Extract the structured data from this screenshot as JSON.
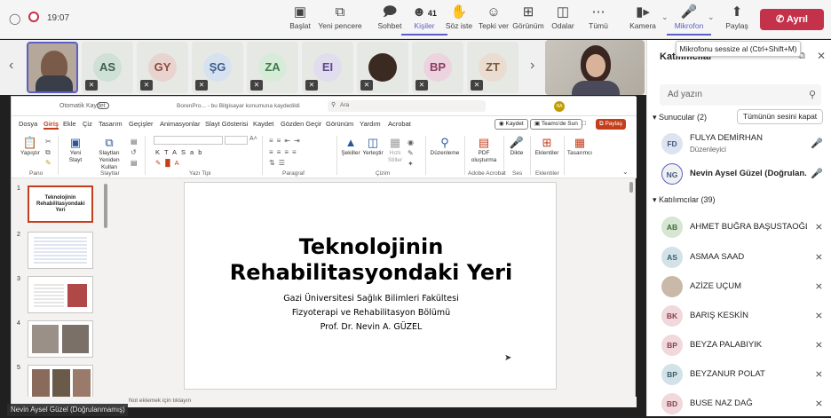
{
  "topbar": {
    "time": "19:07",
    "buttons": [
      {
        "label": "Başlat",
        "icon": "share-screen-icon"
      },
      {
        "label": "Yeni pencere",
        "icon": "new-window-icon"
      },
      {
        "label": "Sohbet",
        "icon": "chat-icon"
      },
      {
        "label": "Kişiler",
        "icon": "people-icon",
        "badge": "41"
      },
      {
        "label": "Söz iste",
        "icon": "raise-hand-icon"
      },
      {
        "label": "Tepki ver",
        "icon": "reaction-icon"
      },
      {
        "label": "Görünüm",
        "icon": "view-icon"
      },
      {
        "label": "Odalar",
        "icon": "rooms-icon"
      },
      {
        "label": "Tümü",
        "icon": "more-icon"
      },
      {
        "label": "Kamera",
        "icon": "camera-icon"
      },
      {
        "label": "Mikrofon",
        "icon": "microphone-icon"
      },
      {
        "label": "Paylaş",
        "icon": "share-icon"
      }
    ],
    "leave_label": "Ayrıl",
    "tooltip": "Mikrofonu sessize al (Ctrl+Shift+M)"
  },
  "strip": {
    "tiles": [
      {
        "initials": "",
        "photo": true
      },
      {
        "initials": "AS",
        "bg": "#cfe0d6",
        "fg": "#3f5e4d"
      },
      {
        "initials": "GY",
        "bg": "#e8d3cf",
        "fg": "#8a4a3e"
      },
      {
        "initials": "ŞG",
        "bg": "#d7e2f1",
        "fg": "#3e5c8a"
      },
      {
        "initials": "ZA",
        "bg": "#d6ecd9",
        "fg": "#3e7a4a"
      },
      {
        "initials": "EI",
        "bg": "#e2dcef",
        "fg": "#5b4a8a"
      },
      {
        "initials": "",
        "photo": true
      },
      {
        "initials": "BP",
        "bg": "#ecd3df",
        "fg": "#8a3e62"
      },
      {
        "initials": "ZT",
        "bg": "#eadcd0",
        "fg": "#7a5a3e"
      }
    ]
  },
  "ppt": {
    "autosave": "Otomatik Kaydet",
    "filename": "BorenPro... - bu Bilgisayar konumuna kaydedildi",
    "search_placeholder": "Ara",
    "user_initials": "NA",
    "save_btn": "Kaydet",
    "teams_btn": "Teams'de Sun",
    "share_btn": "Paylaş",
    "tabs": [
      "Dosya",
      "Giriş",
      "Ekle",
      "Çiz",
      "Tasarım",
      "Geçişler",
      "Animasyonlar",
      "Slayt Gösterisi",
      "Kaydet",
      "Gözden Geçir",
      "Görünüm",
      "Yardım",
      "Acrobat"
    ],
    "ribbon": {
      "paste": "Yapıştır",
      "new_slide": "Yeni Slayt",
      "reuse": "Slaytları Yeniden Kullan",
      "shapes": "Şekiller",
      "arrange": "Yerleştir",
      "quick_styles": "Hızlı Stiller",
      "editing": "Düzenleme",
      "pdf": "PDF oluşturma",
      "dictate": "Dikte",
      "addins": "Eklentiler",
      "designer": "Tasarımcı",
      "groups": [
        "Pano",
        "Slaytlar",
        "Yazı Tipi",
        "Paragraf",
        "Çizim",
        "Adobe Acrobat",
        "Ses",
        "Eklentiler"
      ]
    },
    "thumb_numbers": [
      "1",
      "2",
      "3",
      "4",
      "5"
    ],
    "thumb1_title": "Teknolojinin Rehabilitasyondaki Yeri",
    "slide": {
      "title_line1": "Teknolojinin",
      "title_line2": "Rehabilitasyondaki Yeri",
      "sub1": "Gazi Üniversitesi Sağlık Bilimleri Fakültesi",
      "sub2": "Fizyoterapi ve Rehabilitasyon Bölümü",
      "sub3": "Prof. Dr. Nevin A. GÜZEL"
    },
    "notes": "Not eklemek için tıklayın"
  },
  "name_badge": "Nevin Aysel Güzel (Doğrulanmamış)",
  "panel": {
    "title": "Katılımcılar",
    "search_placeholder": "Ad yazın",
    "presenters_label": "Sunucular (2)",
    "mute_all": "Tümünün sesini kapat",
    "presenters": [
      {
        "initials": "FD",
        "name": "FULYA DEMİRHAN",
        "role": "Düzenleyici",
        "bg": "#dde4f0",
        "fg": "#3e5c8a",
        "muted": false
      },
      {
        "initials": "NG",
        "name": "Nevin Aysel Güzel (Doğrulan...",
        "role": "",
        "bg": "#f0f0f0",
        "fg": "#3e5c8a",
        "muted": false
      }
    ],
    "attendees_label": "Katılımcılar (39)",
    "attendees": [
      {
        "initials": "AB",
        "name": "AHMET BUĞRA BAŞUSTAOĞLU",
        "bg": "#d6e6d2",
        "fg": "#3f6a3a"
      },
      {
        "initials": "AS",
        "name": "ASMAA SAAD",
        "bg": "#d2e2e8",
        "fg": "#3a5f6a"
      },
      {
        "initials": "",
        "name": "AZİZE UÇUM",
        "bg": "#c8b9a8",
        "fg": "#5a4a3a"
      },
      {
        "initials": "BK",
        "name": "BARIŞ KESKİN",
        "bg": "#f0d8dc",
        "fg": "#8a3e4e"
      },
      {
        "initials": "BP",
        "name": "BEYZA PALABIYIK",
        "bg": "#f0d8dc",
        "fg": "#8a3e4e"
      },
      {
        "initials": "BP",
        "name": "BEYZANUR POLAT",
        "bg": "#d2e2e8",
        "fg": "#3a5f6a"
      },
      {
        "initials": "BD",
        "name": "BUSE NAZ DAĞ",
        "bg": "#f0d8dc",
        "fg": "#8a3e4e"
      }
    ]
  }
}
